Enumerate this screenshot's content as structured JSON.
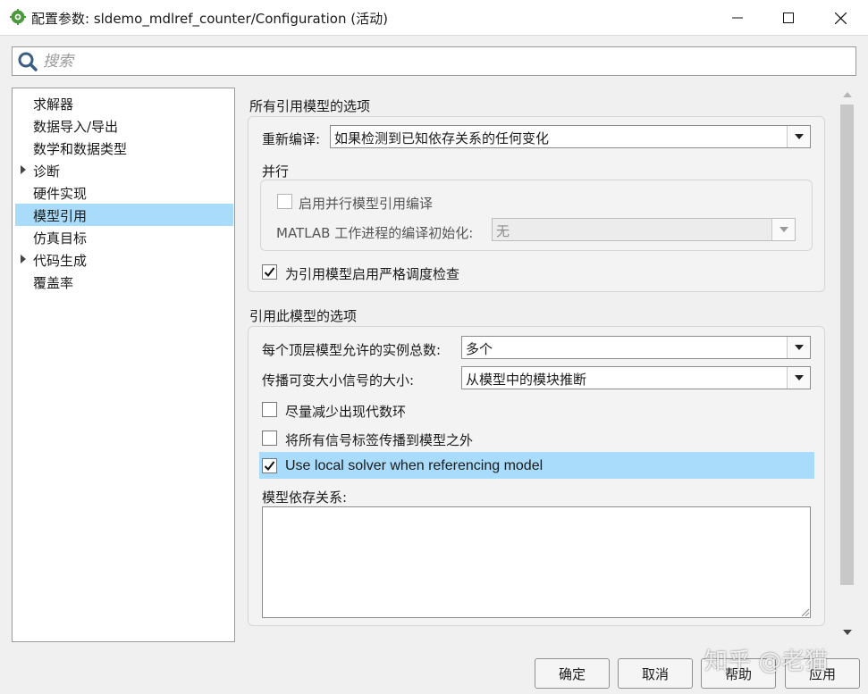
{
  "window": {
    "title": "配置参数: sldemo_mdlref_counter/Configuration (活动)",
    "app_icon": "simulink-gear-icon",
    "controls": [
      "minimize-icon",
      "maximize-icon",
      "close-icon"
    ]
  },
  "search": {
    "placeholder": "搜索",
    "value": ""
  },
  "tree": {
    "items": [
      {
        "label": "求解器",
        "expandable": false,
        "selected": false
      },
      {
        "label": "数据导入/导出",
        "expandable": false,
        "selected": false
      },
      {
        "label": "数学和数据类型",
        "expandable": false,
        "selected": false
      },
      {
        "label": "诊断",
        "expandable": true,
        "selected": false
      },
      {
        "label": "硬件实现",
        "expandable": false,
        "selected": false
      },
      {
        "label": "模型引用",
        "expandable": false,
        "selected": true
      },
      {
        "label": "仿真目标",
        "expandable": false,
        "selected": false
      },
      {
        "label": "代码生成",
        "expandable": true,
        "selected": false
      },
      {
        "label": "覆盖率",
        "expandable": false,
        "selected": false
      }
    ]
  },
  "all_models": {
    "title": "所有引用模型的选项",
    "rebuild_label": "重新编译:",
    "rebuild_value": "如果检测到已知依存关系的任何变化",
    "parallel": {
      "title": "并行",
      "enable_label": "启用并行模型引用编译",
      "enable_checked": false,
      "matlab_init_label": "MATLAB 工作进程的编译初始化:",
      "matlab_init_value": "无"
    },
    "strict_label": "为引用模型启用严格调度检查",
    "strict_checked": true
  },
  "this_model": {
    "title": "引用此模型的选项",
    "instances_label": "每个顶层模型允许的实例总数:",
    "instances_value": "多个",
    "propagate_label": "传播可变大小信号的大小:",
    "propagate_value": "从模型中的模块推断",
    "minimize_label": "尽量减少出现代数环",
    "minimize_checked": false,
    "propagate_signals_label": "将所有信号标签传播到模型之外",
    "propagate_signals_checked": false,
    "local_solver_label": "Use local solver when referencing model",
    "local_solver_checked": true,
    "dependencies_label": "模型依存关系:",
    "dependencies_value": ""
  },
  "buttons": {
    "ok": "确定",
    "cancel": "取消",
    "help": "帮助",
    "apply": "应用"
  },
  "watermark": "知乎 @老猫",
  "colors": {
    "selection": "#a9dcfa",
    "accent_icon": "#3d8a36"
  }
}
